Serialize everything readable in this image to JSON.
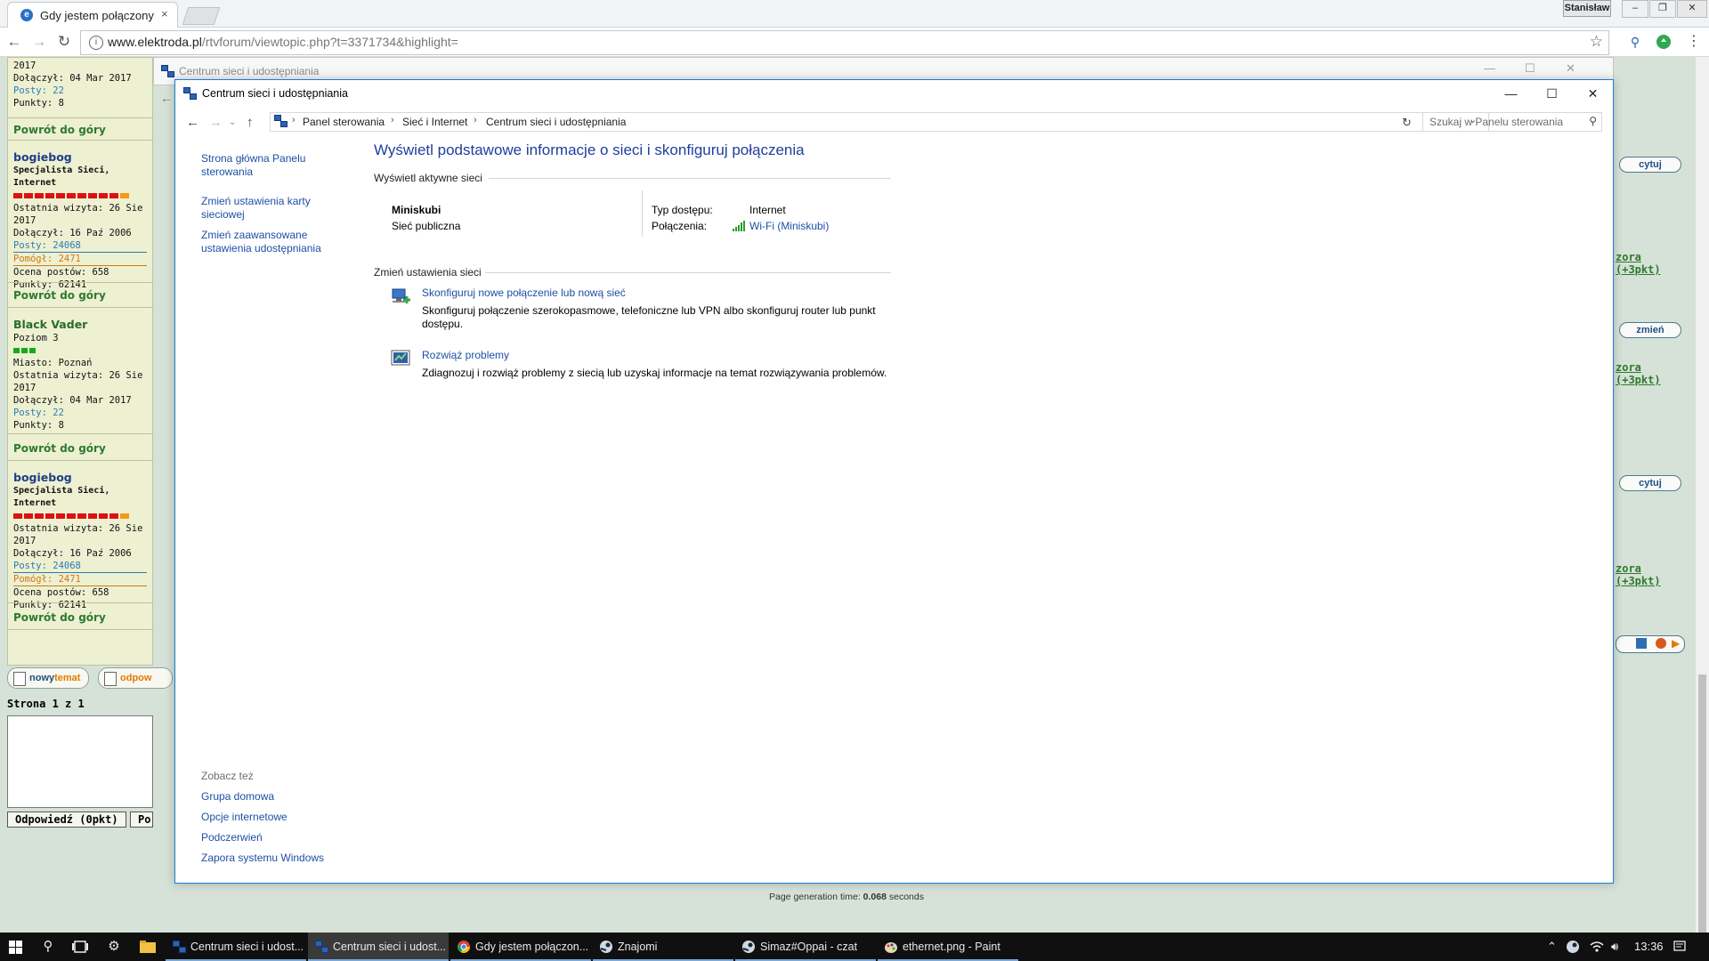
{
  "browser": {
    "tab_title": "Gdy jestem połączony pr",
    "tab_close": "×",
    "user_badge": "Stanisław",
    "url_host": "www.elektroda.pl",
    "url_rest": "/rtvforum/viewtopic.php?t=3371734&highlight=",
    "win_ctl": [
      "–",
      "❐",
      "✕"
    ]
  },
  "forum": {
    "post_top": {
      "year": "2017",
      "joined": "Dołączył: 04 Mar 2017",
      "posts": "Posty: 22",
      "points": "Punkty: 8"
    },
    "back_to_top": "Powrót do góry",
    "post_bogiebog": {
      "name": "bogiebog",
      "rank": "Specjalista Sieci, Internet",
      "last_visit": "Ostatnia wizyta: 26 Sie",
      "last_visit_year": "2017",
      "joined": "Dołączył: 16 Paź 2006",
      "posts": "Posty: 24068",
      "helped": "Pomógł: 2471",
      "rating": "Ocena postów: 658",
      "points": "Punkty: 62141"
    },
    "post_vader": {
      "name": "Black Vader",
      "level": "Poziom 3",
      "city": "Miasto: Poznań",
      "last_visit": "Ostatnia wizyta: 26 Sie",
      "last_visit_year": "2017",
      "joined": "Dołączył: 04 Mar 2017",
      "posts": "Posty: 22",
      "points": "Punkty: 8"
    },
    "new_topic_prefix": "nowy",
    "new_topic_suffix": "temat",
    "reply_pill": "odpow",
    "page_info": "Strona 1 z 1",
    "reply_button": "Odpowiedź (0pkt)",
    "second_button": "Po",
    "right_quote": "cytuj",
    "right_edit": "zmień",
    "right_pkt": "zora (+3pkt)",
    "page_gen_prefix": "Page generation time: ",
    "page_gen_value": "0.068",
    "page_gen_suffix": " seconds"
  },
  "bg_window": {
    "title": "Centrum sieci i udostępniania"
  },
  "window": {
    "title": "Centrum sieci i udostępniania",
    "controls": {
      "minimize": "—",
      "maximize": "☐",
      "close": "✕"
    },
    "breadcrumb": [
      "Panel sterowania",
      "Sieć i Internet",
      "Centrum sieci i udostępniania"
    ],
    "search_placeholder": "Szukaj w Panelu sterowania",
    "left_nav": {
      "home": "Strona główna Panelu sterowania",
      "adapter": "Zmień ustawienia karty sieciowej",
      "sharing": "Zmień zaawansowane ustawienia udostępniania"
    },
    "see_also": {
      "heading": "Zobacz też",
      "items": [
        "Grupa domowa",
        "Opcje internetowe",
        "Podczerwień",
        "Zapora systemu Windows"
      ]
    },
    "main_title": "Wyświetl podstawowe informacje o sieci i skonfiguruj połączenia",
    "active_networks_heading": "Wyświetl aktywne sieci",
    "network": {
      "name": "Miniskubi",
      "type": "Sieć publiczna",
      "access_label": "Typ dostępu:",
      "access_value": "Internet",
      "connections_label": "Połączenia:",
      "connection_link": "Wi-Fi (Miniskubi)"
    },
    "change_settings_heading": "Zmień ustawienia sieci",
    "tasks": [
      {
        "link": "Skonfiguruj nowe połączenie lub nową sieć",
        "desc_line1": "Skonfiguruj połączenie szerokopasmowe, telefoniczne lub VPN albo skonfiguruj router lub punkt",
        "desc_line2": "dostępu."
      },
      {
        "link": "Rozwiąż problemy",
        "desc_line1": "Zdiagnozuj i rozwiąż problemy z siecią lub uzyskaj informacje na temat rozwiązywania problemów."
      }
    ]
  },
  "taskbar": {
    "items": [
      {
        "label": "Centrum sieci i udost...",
        "active": false
      },
      {
        "label": "Centrum sieci i udost...",
        "active": true
      },
      {
        "label": "Gdy jestem połączon...",
        "active": false
      },
      {
        "label": "Znajomi",
        "active": false
      },
      {
        "label": "Simaz#Oppai - czat",
        "active": false
      },
      {
        "label": "ethernet.png - Paint",
        "active": false
      }
    ],
    "clock": "13:36"
  },
  "colors": {
    "link_blue": "#1e4fa4",
    "title_blue": "#1e3f9e",
    "window_border": "#1a7fd4",
    "forum_bg": "#d6e2d7",
    "forum_panel": "#eef0d2",
    "taskbar_bg": "#101010",
    "wifi_green": "#2a9d2a"
  },
  "icons": {
    "browser": [
      "back-icon",
      "forward-icon",
      "reload-icon",
      "info-icon",
      "star-icon",
      "extension-icon",
      "menu-icon"
    ],
    "window": [
      "network-icon",
      "setup-connection-icon",
      "troubleshoot-icon",
      "wifi-signal-icon",
      "search-icon",
      "refresh-icon"
    ],
    "taskbar": [
      "start-icon",
      "search-icon",
      "task-view-icon",
      "settings-icon",
      "file-explorer-icon",
      "chrome-icon",
      "steam-icon",
      "paint-icon",
      "wifi-icon",
      "volume-icon",
      "notifications-icon"
    ]
  }
}
